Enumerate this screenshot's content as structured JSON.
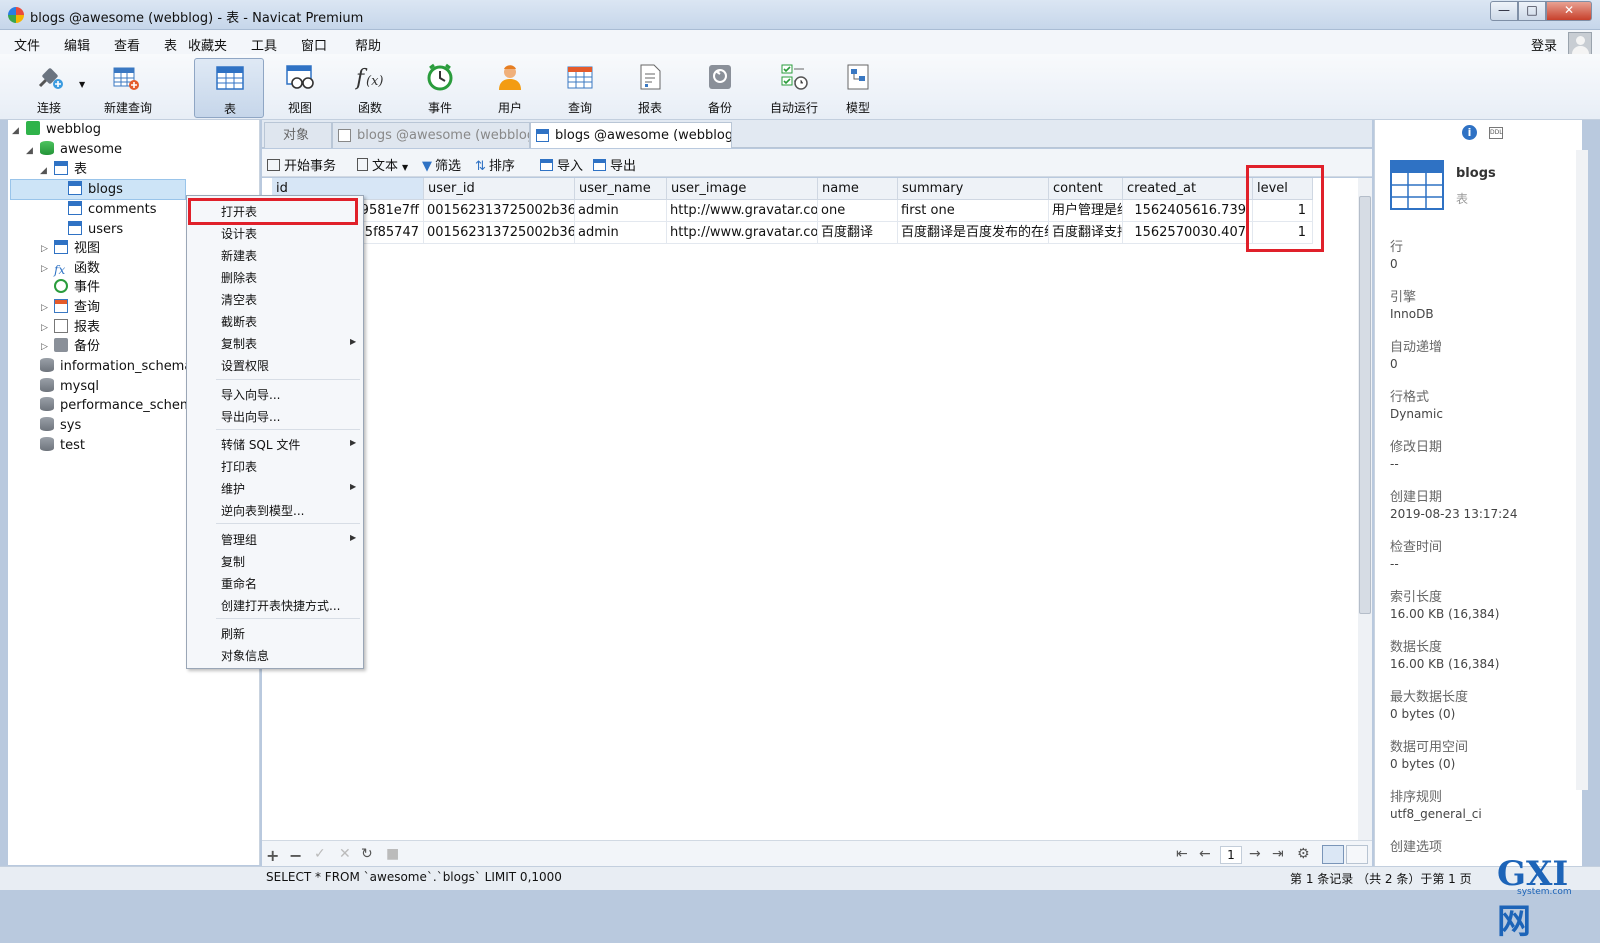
{
  "window": {
    "title": "blogs @awesome (webblog) - 表 - Navicat Premium"
  },
  "menu": [
    "文件",
    "编辑",
    "查看",
    "表",
    "收藏夹",
    "工具",
    "窗口",
    "帮助"
  ],
  "login": "登录",
  "toolbar": [
    "连接",
    "新建查询",
    "表",
    "视图",
    "函数",
    "事件",
    "用户",
    "查询",
    "报表",
    "备份",
    "自动运行",
    "模型"
  ],
  "tree": {
    "connection": "webblog",
    "database": "awesome",
    "tables_group": "表",
    "tables": [
      "blogs",
      "comments",
      "users"
    ],
    "groups": [
      "视图",
      "函数",
      "事件",
      "查询",
      "报表",
      "备份"
    ],
    "databases": [
      "information_schema",
      "mysql",
      "performance_schema",
      "sys",
      "test"
    ]
  },
  "tabs": [
    "对象",
    "blogs @awesome (webblog...",
    "blogs @awesome (webblog..."
  ],
  "subtoolbar": [
    "开始事务",
    "文本",
    "筛选",
    "排序",
    "导入",
    "导出"
  ],
  "grid": {
    "columns": [
      "id",
      "user_id",
      "user_name",
      "user_image",
      "name",
      "summary",
      "content",
      "created_at",
      "level"
    ],
    "rows": [
      [
        "39581e7ff",
        "001562313725002b3610c",
        "admin",
        "http://www.gravatar.com/",
        "one",
        "first one",
        "用户管理是绝",
        "1562405616.739",
        "1"
      ],
      [
        "075f85747",
        "001562313725002b3610c",
        "admin",
        "http://www.gravatar.com/",
        "百度翻译",
        "百度翻译是百度发布的在线翻",
        "百度翻译支持",
        "1562570030.407",
        "1"
      ]
    ]
  },
  "context_menu": [
    "打开表",
    "设计表",
    "新建表",
    "删除表",
    "清空表",
    "截断表",
    "复制表",
    "设置权限",
    "导入向导...",
    "导出向导...",
    "转储 SQL 文件",
    "打印表",
    "维护",
    "逆向表到模型...",
    "管理组",
    "复制",
    "重命名",
    "创建打开表快捷方式...",
    "刷新",
    "对象信息"
  ],
  "info": {
    "name": "blogs",
    "type": "表",
    "props": [
      {
        "label": "行",
        "value": "0"
      },
      {
        "label": "引擎",
        "value": "InnoDB"
      },
      {
        "label": "自动递增",
        "value": "0"
      },
      {
        "label": "行格式",
        "value": "Dynamic"
      },
      {
        "label": "修改日期",
        "value": "--"
      },
      {
        "label": "创建日期",
        "value": "2019-08-23 13:17:24"
      },
      {
        "label": "检查时间",
        "value": "--"
      },
      {
        "label": "索引长度",
        "value": "16.00 KB (16,384)"
      },
      {
        "label": "数据长度",
        "value": "16.00 KB (16,384)"
      },
      {
        "label": "最大数据长度",
        "value": "0 bytes (0)"
      },
      {
        "label": "数据可用空间",
        "value": "0 bytes (0)"
      },
      {
        "label": "排序规则",
        "value": "utf8_general_ci"
      },
      {
        "label": "创建选项",
        "value": ""
      }
    ]
  },
  "pager": {
    "page": "1"
  },
  "status": {
    "sql": "SELECT * FROM `awesome`.`blogs` LIMIT 0,1000",
    "records": "第 1 条记录 （共 2 条）于第 1 页"
  },
  "watermark": {
    "logo": "GXI网",
    "site": "system.com"
  },
  "colors": {
    "highlight": "#e0202a",
    "selection": "#cde4f7",
    "accent": "#1d64b8"
  }
}
